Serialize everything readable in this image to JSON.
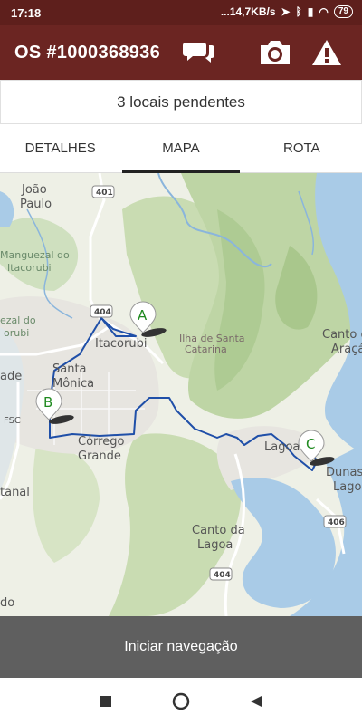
{
  "status_bar": {
    "time": "17:18",
    "network": "...14,7KB/s",
    "battery": "79"
  },
  "app_bar": {
    "title": "OS #1000368936",
    "icons": [
      "chat-icon",
      "camera-icon",
      "warning-icon"
    ]
  },
  "pending_text": "3 locais pendentes",
  "tabs": [
    {
      "label": "DETALHES",
      "active": false
    },
    {
      "label": "MAPA",
      "active": true
    },
    {
      "label": "ROTA",
      "active": false
    }
  ],
  "map": {
    "place_labels": {
      "joao_paulo_1": "João",
      "joao_paulo_2": "Paulo",
      "manguezal_1": "Manguezal do",
      "manguezal_2": "Itacorubi",
      "manguezal2_1": "ezal do",
      "manguezal2_2": "orubi",
      "itacorubi": "Itacorubi",
      "ilha_1": "Ilha de Santa",
      "ilha_2": "Catarina",
      "santa_monica_1": "Santa",
      "santa_monica_2": "Mônica",
      "ade": "ade",
      "fsc": "FSC",
      "corrego_1": "Córrego",
      "corrego_2": "Grande",
      "lagoa": "Lagoa",
      "dunas_1": "Dunas",
      "dunas_2": "Lagoa",
      "canto_araca_1": "Canto d",
      "canto_araca_2": "Araçá",
      "tanal": "tanal",
      "canto_lagoa_1": "Canto da",
      "canto_lagoa_2": "Lagoa",
      "do": "do"
    },
    "road_shields": [
      "401",
      "404",
      "406",
      "404"
    ],
    "markers": [
      "A",
      "B",
      "C"
    ],
    "colors": {
      "water": "#a9cbe7",
      "route": "#1f4fa8",
      "marker_text": "#1f8a1f"
    }
  },
  "navigation_button": "Iniciar navegação",
  "system_nav": [
    "stop-icon",
    "home-icon",
    "back-icon"
  ]
}
